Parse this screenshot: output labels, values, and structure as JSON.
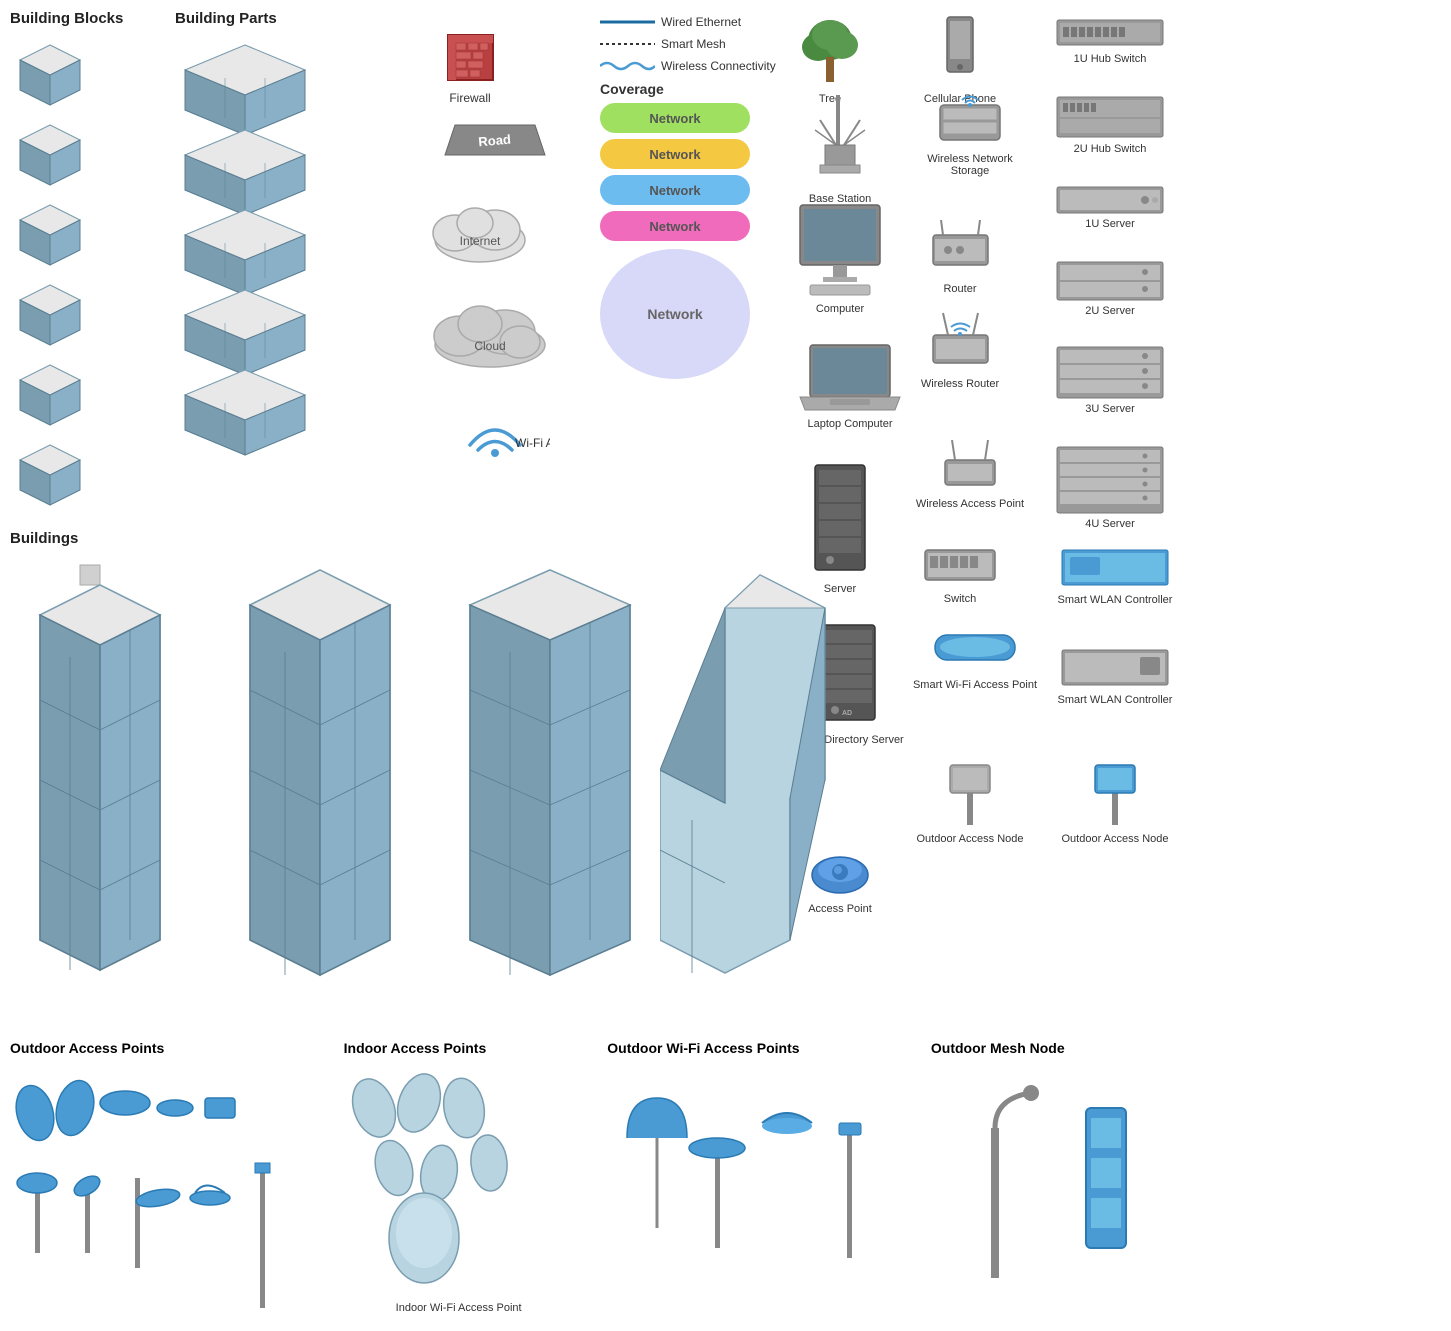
{
  "sections": {
    "building_blocks": "Building Blocks",
    "building_parts": "Building Parts",
    "buildings": "Buildings",
    "outdoor_access_points": "Outdoor Access Points",
    "indoor_access_points": "Indoor Access Points",
    "indoor_wifi_ap": "Indoor Wi-Fi\nAccess Point",
    "outdoor_wifi_ap": "Outdoor Wi-Fi Access Points",
    "outdoor_mesh_node": "Outdoor Mesh Node"
  },
  "connectivity": {
    "wired_ethernet": "Wired Ethernet",
    "smart_mesh": "Smart Mesh",
    "wireless_connectivity": "Wireless Connectivity",
    "coverage": "Coverage"
  },
  "network_labels": {
    "network": "Network"
  },
  "misc_icons": [
    {
      "id": "firewall",
      "label": "Firewall"
    },
    {
      "id": "road",
      "label": "Road"
    },
    {
      "id": "internet",
      "label": "Internet"
    },
    {
      "id": "cloud",
      "label": "Cloud"
    },
    {
      "id": "wifi_access",
      "label": "Wi-Fi Access"
    },
    {
      "id": "tree",
      "label": "Tree"
    }
  ],
  "device_icons": [
    {
      "id": "base_station",
      "label": "Base Station"
    },
    {
      "id": "computer",
      "label": "Computer"
    },
    {
      "id": "laptop_computer",
      "label": "Laptop Computer"
    },
    {
      "id": "server",
      "label": "Server"
    },
    {
      "id": "active_directory_server",
      "label": "Active Directory Server"
    },
    {
      "id": "access_point",
      "label": "Access Point"
    },
    {
      "id": "cellular_phone",
      "label": "Cellular Phone"
    },
    {
      "id": "wireless_network_storage",
      "label": "Wireless Network Storage"
    },
    {
      "id": "router",
      "label": "Router"
    },
    {
      "id": "wireless_router",
      "label": "Wireless Router"
    },
    {
      "id": "wireless_access_point",
      "label": "Wireless Access Point"
    },
    {
      "id": "switch",
      "label": "Switch"
    },
    {
      "id": "smart_wifi_ap",
      "label": "Smart Wi-Fi Access Point"
    },
    {
      "id": "outdoor_access_node_gray",
      "label": "Outdoor Access Node"
    },
    {
      "id": "outdoor_access_node_blue",
      "label": "Outdoor Access Node"
    },
    {
      "id": "1u_hub_switch",
      "label": "1U Hub Switch"
    },
    {
      "id": "2u_hub_switch",
      "label": "2U Hub Switch"
    },
    {
      "id": "1u_server",
      "label": "1U Server"
    },
    {
      "id": "2u_server",
      "label": "2U Server"
    },
    {
      "id": "3u_server",
      "label": "3U Server"
    },
    {
      "id": "4u_server",
      "label": "4U Server"
    },
    {
      "id": "smart_wlan_controller_1",
      "label": "Smart WLAN Controller"
    },
    {
      "id": "smart_wlan_controller_2",
      "label": "Smart WLAN Controller"
    }
  ],
  "coverage_colors": [
    "#a0e060",
    "#f5c842",
    "#6dbcf0",
    "#f06bbb",
    "#d8d8f8"
  ],
  "colors": {
    "building_face": "#b8d4e0",
    "building_top": "#e8e8e8",
    "building_side": "#7a9db0",
    "accent_blue": "#1a6ba0"
  }
}
